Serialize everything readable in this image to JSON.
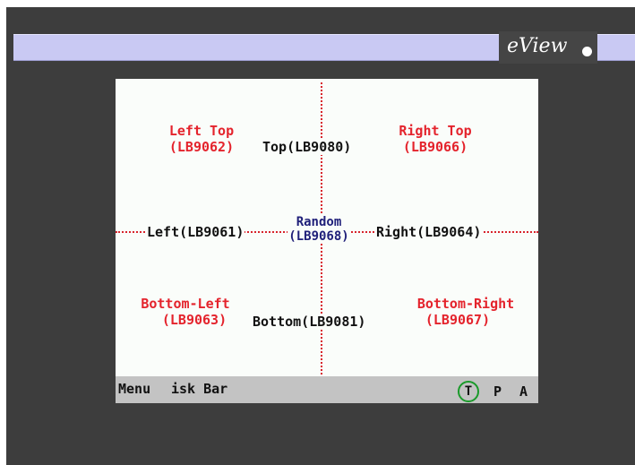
{
  "header": {
    "logo_text": "eView"
  },
  "labels": {
    "left_top_1": "Left Top",
    "left_top_2": "(LB9062)",
    "top": "Top(LB9080)",
    "right_top_1": "Right Top",
    "right_top_2": "(LB9066)",
    "left": "Left(LB9061)",
    "random_1": "Random",
    "random_2": "(LB9068)",
    "right": "Right(LB9064)",
    "bottom_left_1": "Bottom-Left",
    "bottom_left_2": "(LB9063)",
    "bottom": "Bottom(LB9081)",
    "bottom_right_1": "Bottom-Right",
    "bottom_right_2": "(LB9067)"
  },
  "taskbar": {
    "menu": "Menu",
    "task_bar": "isk Bar",
    "t": "T",
    "p": "P",
    "a": "A"
  },
  "colors": {
    "frame": "#3d3d3d",
    "topbar": "#c9c9f3",
    "screen": "#fafdfa",
    "red_label": "#e4232c",
    "blue_label": "#20207a",
    "dotted_line": "#d8242c",
    "taskbar": "#c3c3c3",
    "t_circle": "#1a9a2a"
  }
}
